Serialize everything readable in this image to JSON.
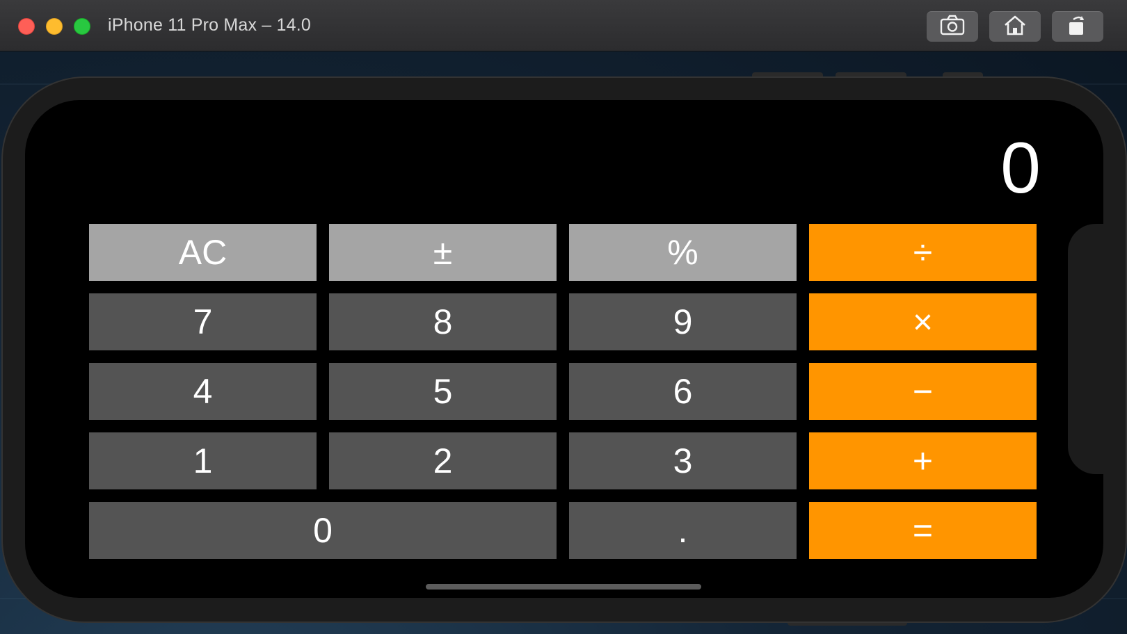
{
  "window": {
    "title": "iPhone 11 Pro Max – 14.0",
    "toolbar": {
      "screenshot_icon": "camera-icon",
      "home_icon": "home-icon",
      "rotate_icon": "rotate-icon"
    }
  },
  "calculator": {
    "display": "0",
    "keys": {
      "ac": "AC",
      "plus_minus": "±",
      "percent": "%",
      "divide": "÷",
      "seven": "7",
      "eight": "8",
      "nine": "9",
      "multiply": "×",
      "four": "4",
      "five": "5",
      "six": "6",
      "minus": "−",
      "one": "1",
      "two": "2",
      "three": "3",
      "plus": "+",
      "zero": "0",
      "decimal": ".",
      "equals": "="
    }
  },
  "colors": {
    "function_key": "#a5a5a5",
    "number_key": "#545454",
    "operator_key": "#ff9500",
    "screen": "#000000"
  }
}
